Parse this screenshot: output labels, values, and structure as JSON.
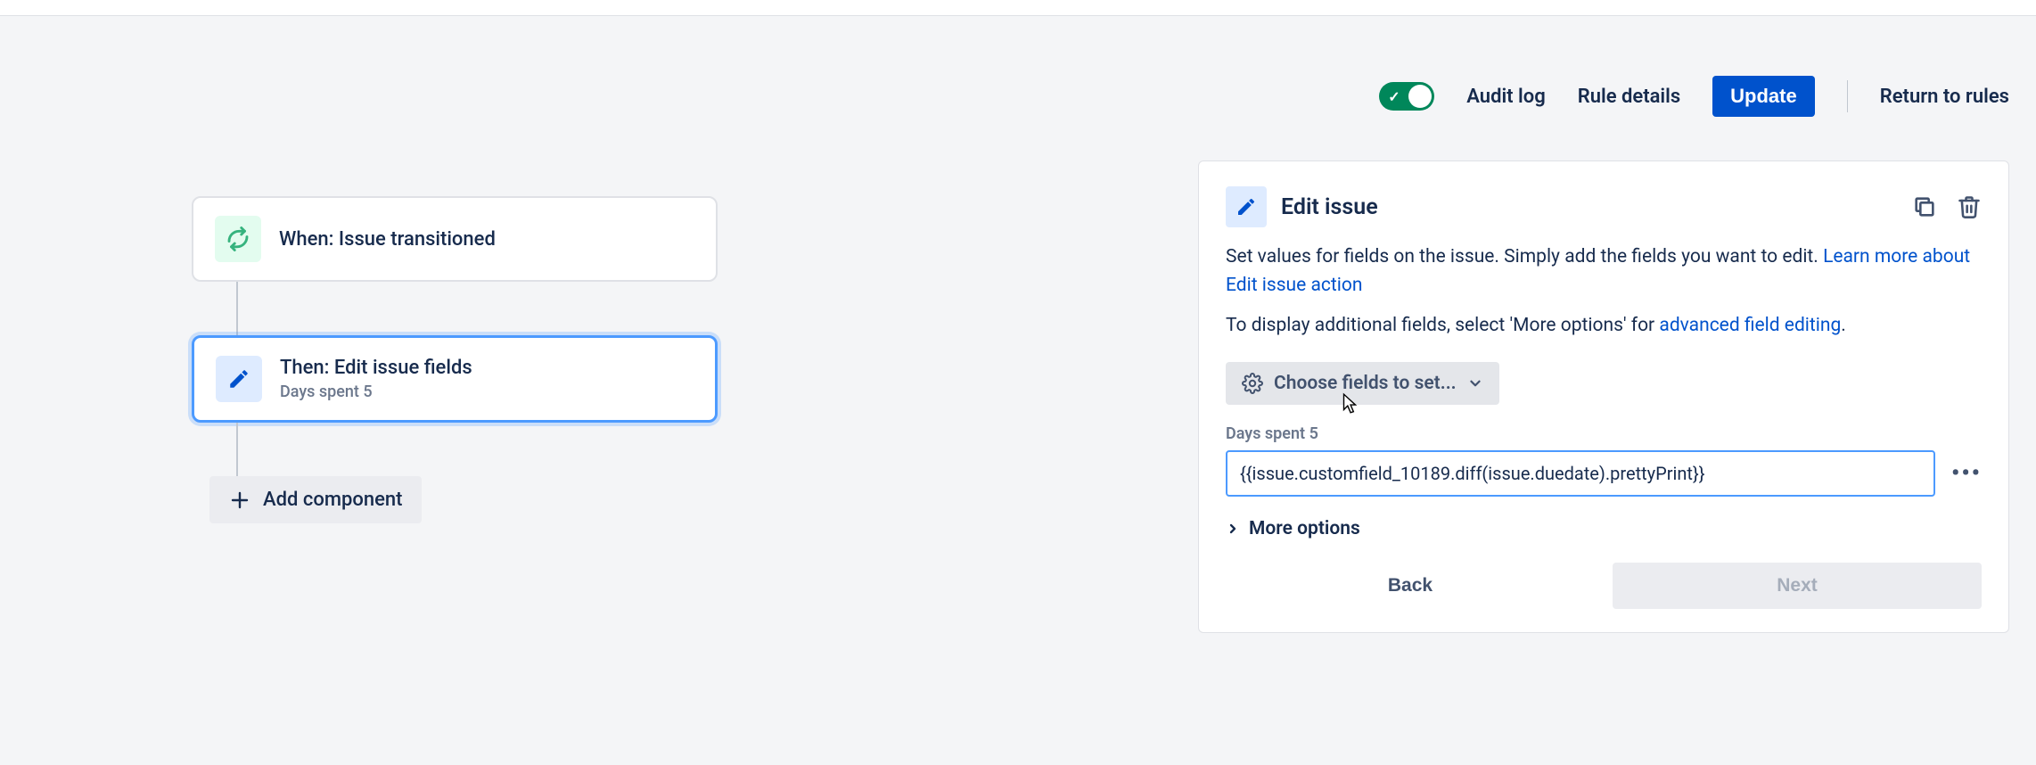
{
  "actionbar": {
    "audit_log": "Audit log",
    "rule_details": "Rule details",
    "update": "Update",
    "return": "Return to rules"
  },
  "flow": {
    "trigger": {
      "title": "When: Issue transitioned"
    },
    "action": {
      "title": "Then: Edit issue fields",
      "subtitle": "Days spent 5"
    },
    "add_component": "Add component"
  },
  "panel": {
    "title": "Edit issue",
    "desc1a": "Set values for fields on the issue. Simply add the fields you want to edit. ",
    "desc1_link": "Learn more about Edit issue action",
    "desc2a": "To display additional fields, select 'More options' for ",
    "desc2_link": "advanced field editing",
    "desc2b": ".",
    "choose_fields": "Choose fields to set...",
    "field_label": "Days spent 5",
    "field_value": "{{issue.customfield_10189.diff(issue.duedate).prettyPrint}}",
    "more_options": "More options",
    "back": "Back",
    "next": "Next"
  }
}
